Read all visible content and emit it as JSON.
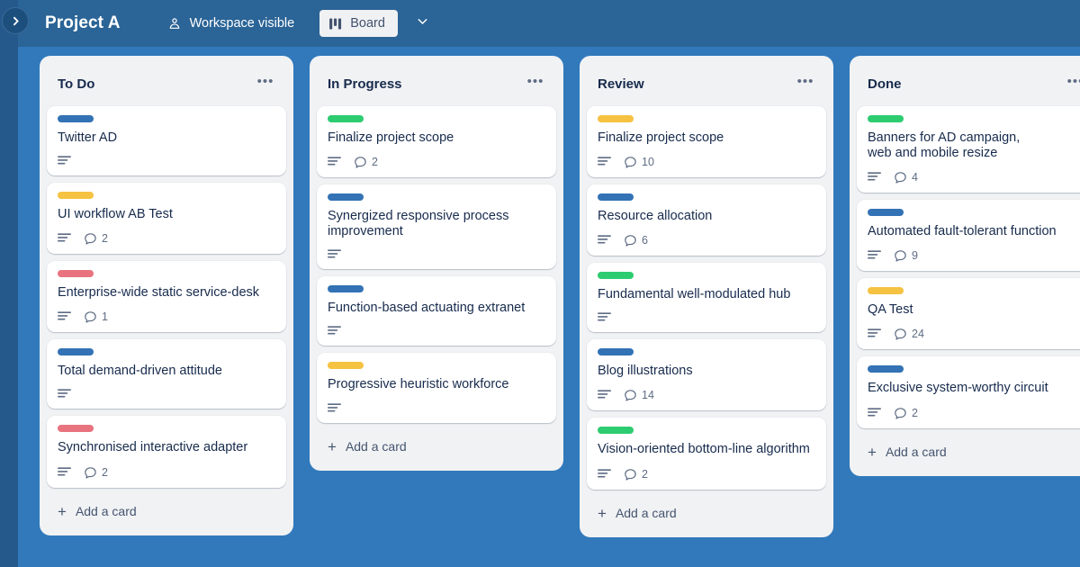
{
  "colors": {
    "app_bar": "#2b6496",
    "board_bg": "#3179bb",
    "rail": "#25598c",
    "list_bg": "#f1f2f4",
    "card_bg": "#ffffff",
    "label_blue": "#3372b5",
    "label_green": "#2dcc70",
    "label_yellow": "#f5c242",
    "label_red": "#e8737f"
  },
  "topbar": {
    "sidebar_toggle_icon": "chevron-right-icon",
    "board_title": "Project A",
    "visibility_icon": "workspace-visible-icon",
    "visibility_label": "Workspace visible",
    "board_view_icon": "board-columns-icon",
    "board_view_label": "Board",
    "caret_icon": "chevron-down-icon"
  },
  "lists": [
    {
      "title": "To Do",
      "menu_icon": "list-actions-icon",
      "menu_glyph": "•••",
      "add_card_label": "Add a card",
      "cards": [
        {
          "label_color": "label_blue",
          "title_lines": [
            "Twitter AD"
          ],
          "has_description": true,
          "comments": null
        },
        {
          "label_color": "label_yellow",
          "title_lines": [
            "UI workflow AB Test"
          ],
          "has_description": true,
          "comments": "2"
        },
        {
          "label_color": "label_red",
          "title_lines": [
            "Enterprise-wide static service-desk"
          ],
          "has_description": true,
          "comments": "1"
        },
        {
          "label_color": "label_blue",
          "title_lines": [
            "Total demand-driven attitude"
          ],
          "has_description": true,
          "comments": null
        },
        {
          "label_color": "label_red",
          "title_lines": [
            "Synchronised interactive adapter"
          ],
          "has_description": true,
          "comments": "2"
        }
      ]
    },
    {
      "title": "In Progress",
      "menu_icon": "list-actions-icon",
      "menu_glyph": "•••",
      "add_card_label": "Add a card",
      "cards": [
        {
          "label_color": "label_green",
          "title_lines": [
            "Finalize project scope"
          ],
          "has_description": true,
          "comments": "2"
        },
        {
          "label_color": "label_blue",
          "title_lines": [
            "Synergized responsive process",
            "improvement"
          ],
          "has_description": true,
          "comments": null
        },
        {
          "label_color": "label_blue",
          "title_lines": [
            "Function-based actuating extranet"
          ],
          "has_description": true,
          "comments": null
        },
        {
          "label_color": "label_yellow",
          "title_lines": [
            "Progressive heuristic workforce"
          ],
          "has_description": true,
          "comments": null
        }
      ]
    },
    {
      "title": "Review",
      "menu_icon": "list-actions-icon",
      "menu_glyph": "•••",
      "add_card_label": "Add a card",
      "cards": [
        {
          "label_color": "label_yellow",
          "title_lines": [
            "Finalize project scope"
          ],
          "has_description": true,
          "comments": "10"
        },
        {
          "label_color": "label_blue",
          "title_lines": [
            "Resource allocation"
          ],
          "has_description": true,
          "comments": "6"
        },
        {
          "label_color": "label_green",
          "title_lines": [
            "Fundamental well-modulated hub"
          ],
          "has_description": true,
          "comments": null
        },
        {
          "label_color": "label_blue",
          "title_lines": [
            "Blog illustrations"
          ],
          "has_description": true,
          "comments": "14"
        },
        {
          "label_color": "label_green",
          "title_lines": [
            "Vision-oriented bottom-line algorithm"
          ],
          "has_description": true,
          "comments": "2"
        }
      ]
    },
    {
      "title": "Done",
      "menu_icon": "list-actions-icon",
      "menu_glyph": "•••",
      "add_card_label": "Add a card",
      "cards": [
        {
          "label_color": "label_green",
          "title_lines": [
            "Banners for AD campaign,",
            "web and mobile resize"
          ],
          "has_description": true,
          "comments": "4"
        },
        {
          "label_color": "label_blue",
          "title_lines": [
            "Automated fault-tolerant function"
          ],
          "has_description": true,
          "comments": "9"
        },
        {
          "label_color": "label_yellow",
          "title_lines": [
            "QA Test"
          ],
          "has_description": true,
          "comments": "24"
        },
        {
          "label_color": "label_blue",
          "title_lines": [
            "Exclusive system-worthy circuit"
          ],
          "has_description": true,
          "comments": "2"
        }
      ]
    }
  ]
}
